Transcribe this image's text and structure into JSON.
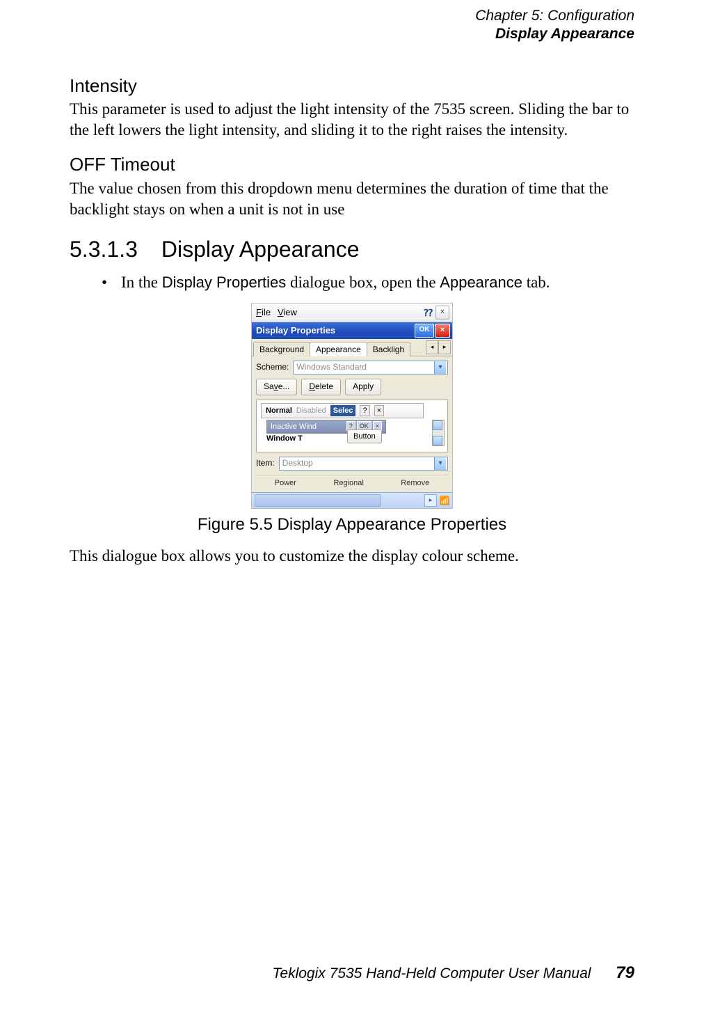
{
  "header": {
    "chapter": "Chapter 5: Configuration",
    "section": "Display Appearance"
  },
  "intensity": {
    "heading": "Intensity",
    "text": "This parameter is used to adjust the light intensity of the 7535 screen. Sliding the bar to the left lowers the light intensity, and sliding it to the right raises the intensity."
  },
  "off_timeout": {
    "heading": "OFF Timeout",
    "text": "The value chosen from this dropdown menu determines the duration of time that the backlight stays on when a unit is not in use"
  },
  "section_5313": {
    "number": "5.3.1.3",
    "title": "Display Appearance",
    "bullet_prefix": "In the ",
    "bullet_sans1": "Display Properties",
    "bullet_mid": " dialogue box, open the ",
    "bullet_sans2": "Appearance",
    "bullet_suffix": " tab."
  },
  "screenshot": {
    "menu_file_u": "F",
    "menu_file_rest": "ile",
    "menu_view_u": "V",
    "menu_view_rest": "iew",
    "title": "Display Properties",
    "title_ok": "OK",
    "title_close": "×",
    "tab_background": "Background",
    "tab_appearance": "Appearance",
    "tab_backlight": "Backligh",
    "scheme_label": "Scheme:",
    "scheme_value": "Windows Standard",
    "btn_save_u": "v",
    "btn_save": "Sa",
    "btn_save_suffix": "e...",
    "btn_delete_u": "D",
    "btn_delete": "elete",
    "btn_apply": "Apply",
    "preview_normal": "Normal",
    "preview_disabled": "Disabled",
    "preview_selec": "Selec",
    "preview_q": "?",
    "preview_x": "×",
    "preview_inactive": "Inactive Wind",
    "preview_inactive_q": "?",
    "preview_inactive_ok": "OK",
    "preview_inactive_x": "×",
    "preview_window_text": "Window T",
    "preview_button": "Button",
    "item_label": "Item:",
    "item_value": "Desktop",
    "bottom_power": "Power",
    "bottom_regional": "Regional",
    "bottom_remove": "Remove"
  },
  "figure_caption": "Figure 5.5 Display Appearance Properties",
  "closing_para": "This dialogue box allows you to customize the display colour scheme.",
  "footer": {
    "manual": "Teklogix 7535 Hand-Held Computer User Manual",
    "page": "79"
  }
}
